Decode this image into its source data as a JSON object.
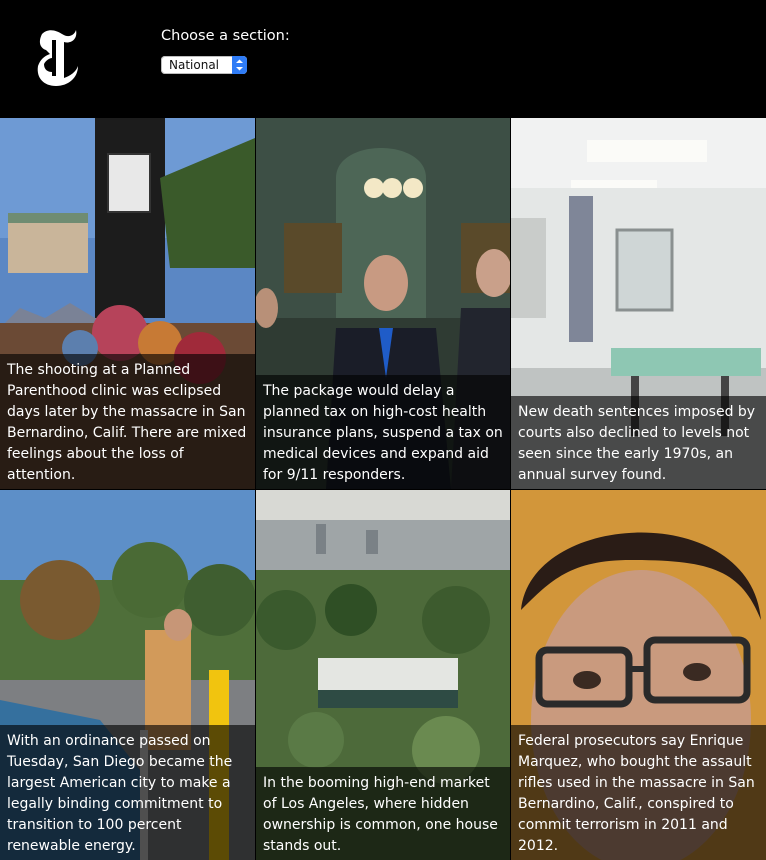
{
  "header": {
    "logo_icon": "nyt-t-logo-icon",
    "section_label": "Choose a section:",
    "section_select_value": "National"
  },
  "articles": [
    {
      "summary": "The shooting at a Planned Parenthood clinic was eclipsed days later by the massacre in San Bernardino, Calif. There are mixed feelings about the loss of attention."
    },
    {
      "summary": "The package would delay a planned tax on high-cost health insurance plans, suspend a tax on medical devices and expand aid for 9/11 responders."
    },
    {
      "summary": "New death sentences imposed by courts also declined to levels not seen since the early 1970s, an annual survey found."
    },
    {
      "summary": "With an ordinance passed on Tuesday, San Diego became the largest American city to make a legally binding commitment to transition to 100 percent renewable energy."
    },
    {
      "summary": "In the booming high-end market of Los Angeles, where hidden ownership is common, one house stands out."
    },
    {
      "summary": "Federal prosecutors say Enrique Marquez, who bought the assault rifles used in the massacre in San Bernardino, Calif., conspired to commit terrorism in 2011 and 2012."
    }
  ]
}
